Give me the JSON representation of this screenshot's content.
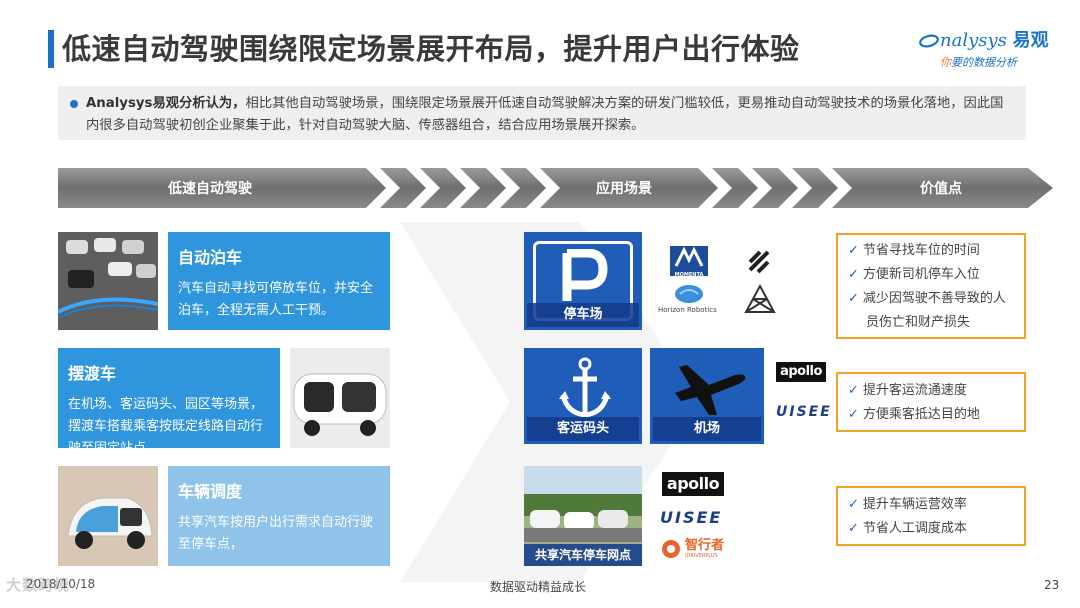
{
  "title": "低速自动驾驶围绕限定场景展开布局，提升用户出行体验",
  "logo": {
    "brand": "nalysys",
    "brand_cn": "易观",
    "tagline_accent": "你",
    "tagline": "要的数据分析"
  },
  "summary": {
    "lead": "Analysys易观分析认为，",
    "text": "相比其他自动驾驶场景，围绕限定场景展开低速自动驾驶解决方案的研发门槛较低，更易推动自动驾驶技术的场景化落地，因此国内很多自动驾驶初创企业聚集于此，针对自动驾驶大脑、传感器组合，结合应用场景展开探索。"
  },
  "headers": {
    "col1": "低速自动驾驶",
    "col2": "应用场景",
    "col3": "价值点"
  },
  "scenarios": [
    {
      "title": "自动泊车",
      "desc": "汽车自动寻找可停放车位，并安全泊车，全程无需人工干预。"
    },
    {
      "title": "摆渡车",
      "desc": "在机场、客运码头、园区等场景，摆渡车搭载乘客按既定线路自动行驶至固定站点，"
    },
    {
      "title": "车辆调度",
      "desc": "共享汽车按用户出行需求自动行驶至停车点，"
    }
  ],
  "scenes": {
    "parking": "停车场",
    "port": "客运码头",
    "airport": "机场",
    "carshare": "共享汽车停车网点"
  },
  "companies": {
    "momenta": "MOMENTA",
    "horizon": "Horizon Robotics",
    "apollo": "apollo",
    "uisee": "UISEE",
    "zhixingzhe": "智行者",
    "zhixingzhe_en": "IDRIVERPLUS"
  },
  "values": [
    [
      "节省寻找车位的时间",
      "方便新司机停车入位",
      "减少因驾驶不善导致的人",
      "员伤亡和财产损失"
    ],
    [
      "提升客运流通速度",
      "方便乘客抵达目的地"
    ],
    [
      "提升车辆运营效率",
      "节省人工调度成本"
    ]
  ],
  "footer": {
    "date": "2018/10/18",
    "center": "数据驱动精益成长",
    "page": "23",
    "watermark": "大数跨境"
  },
  "colors": {
    "accent": "#1a73c9",
    "scenario_blue": "#2f95dd",
    "scenario_light": "#8fc3ea",
    "value_border": "#f2a32a",
    "header_gray": "#7a7a7a"
  }
}
